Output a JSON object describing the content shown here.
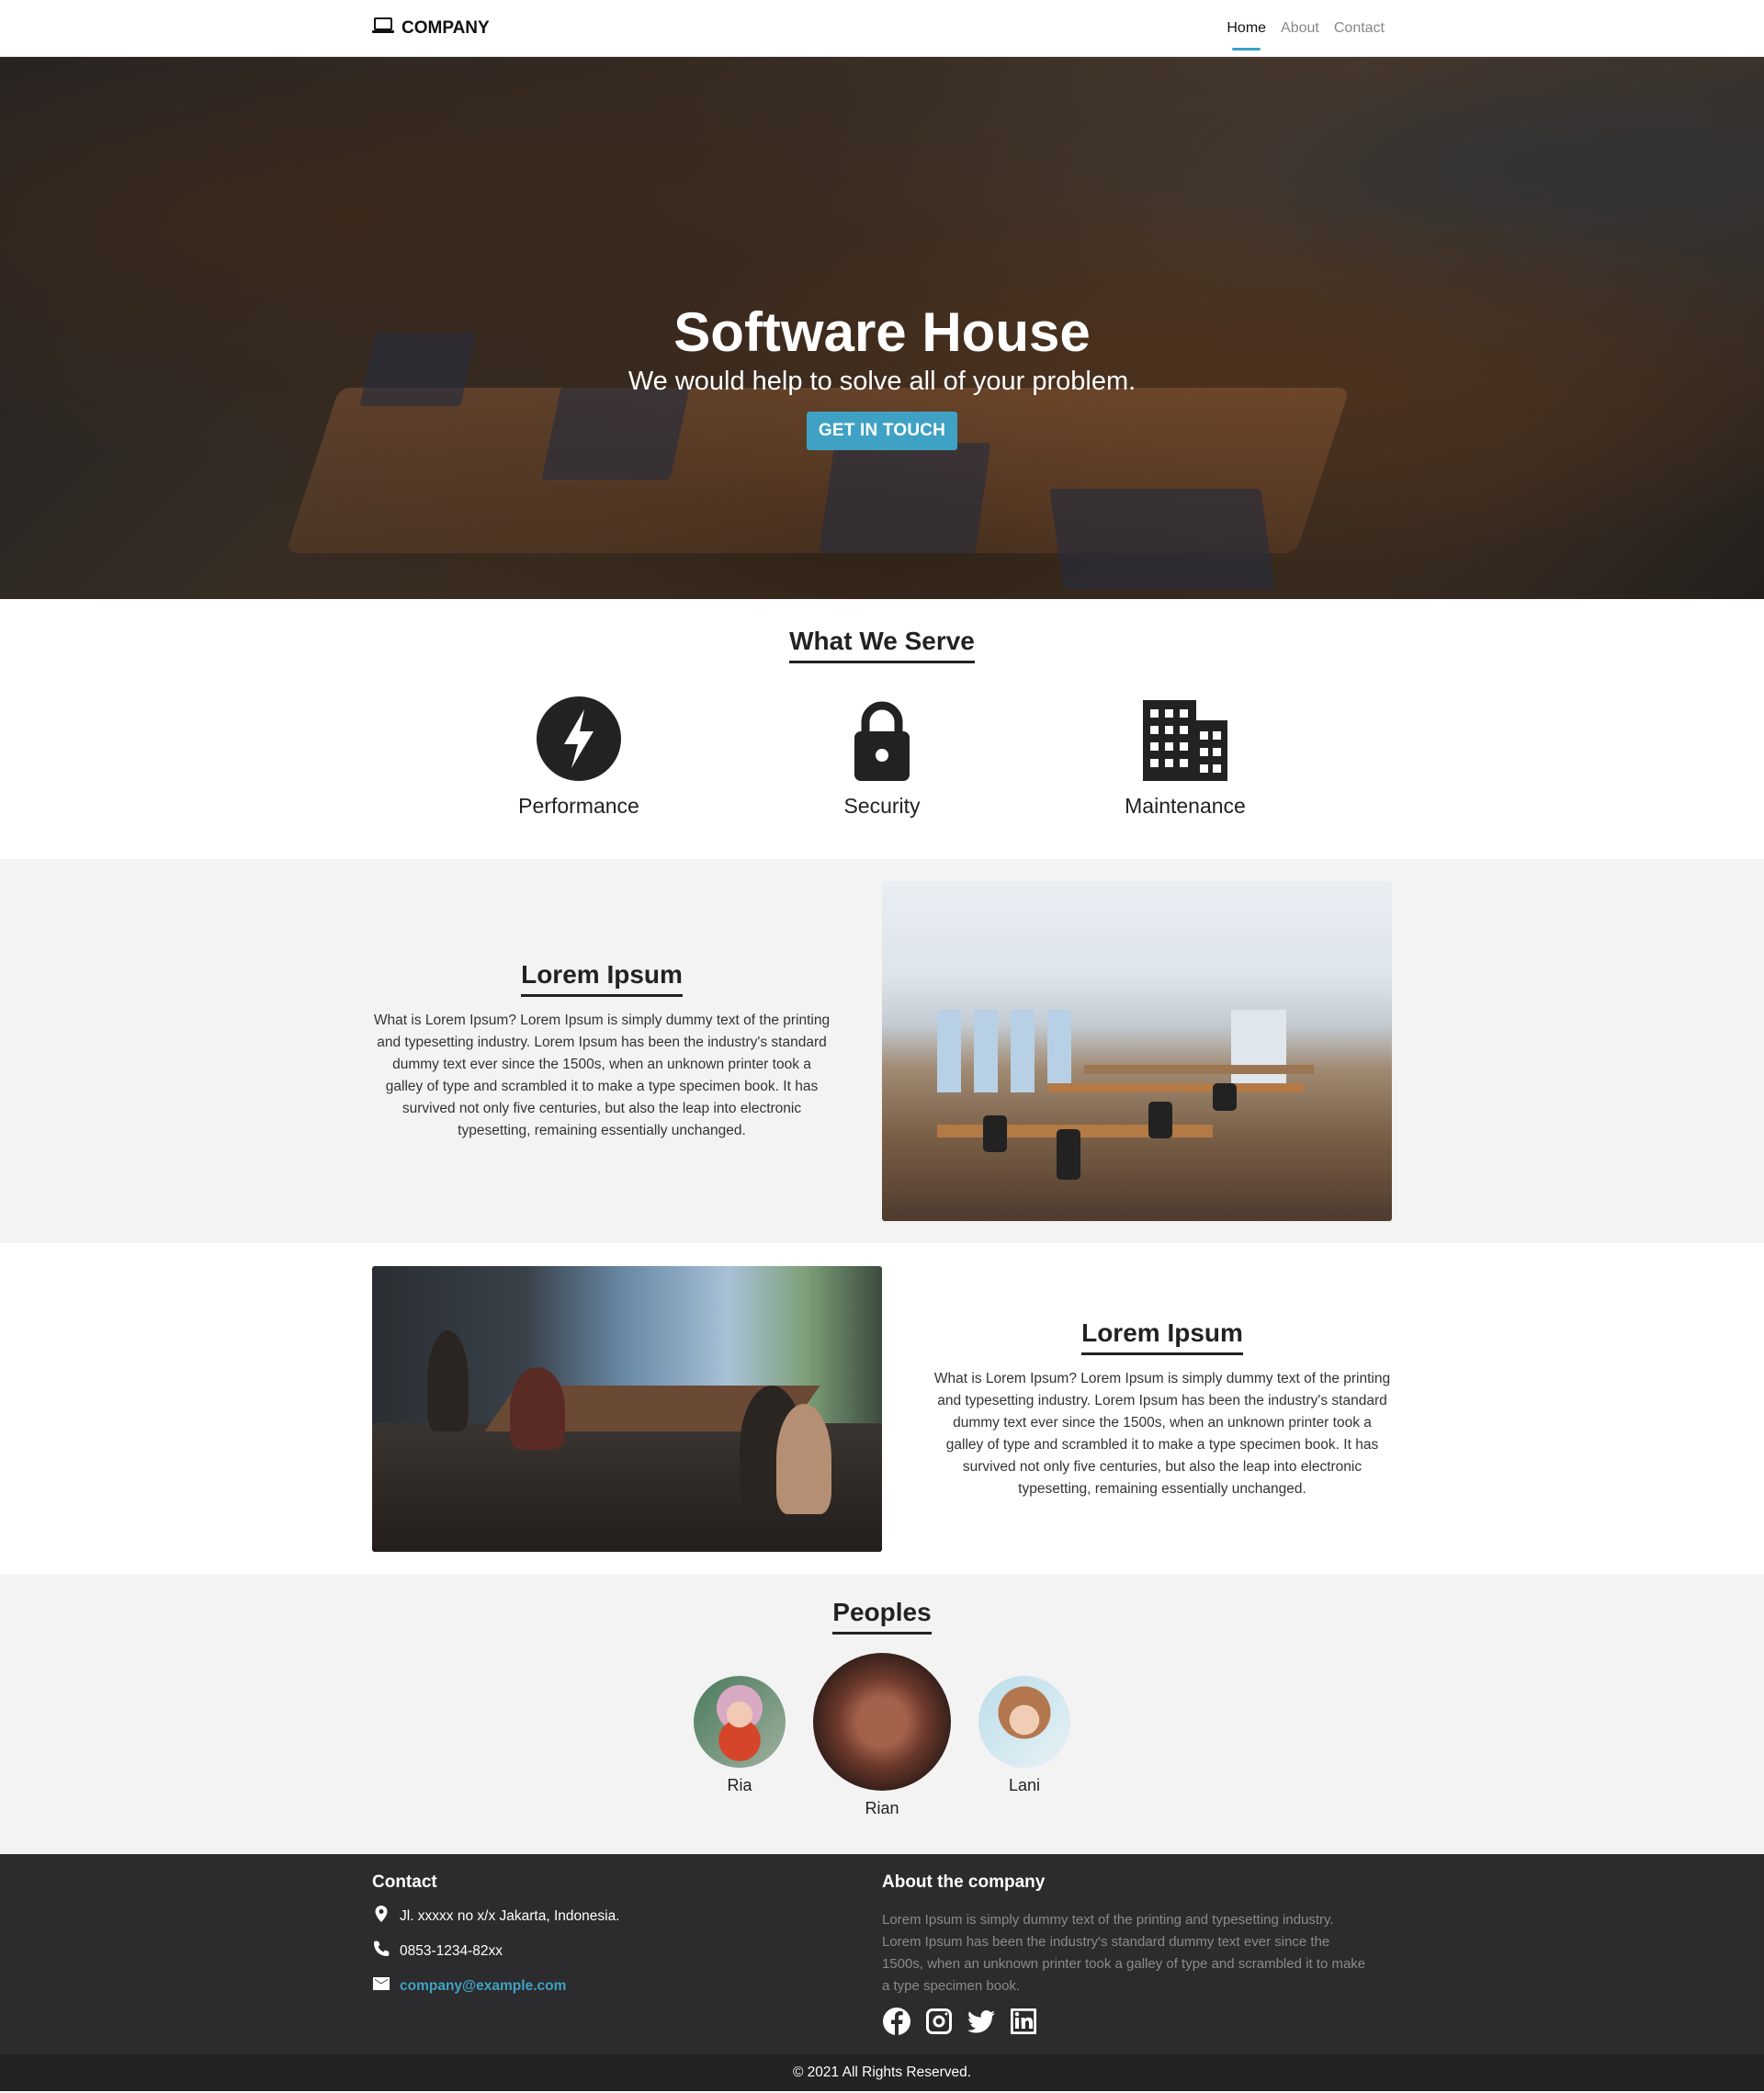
{
  "navbar": {
    "brand": "COMPANY",
    "links": [
      {
        "label": "Home",
        "active": true
      },
      {
        "label": "About",
        "active": false
      },
      {
        "label": "Contact",
        "active": false
      }
    ],
    "active_color": "#3aa2c4"
  },
  "hero": {
    "title": "Software House",
    "subtitle": "We would help to solve all of your problem.",
    "cta_label": "GET IN TOUCH",
    "cta_color": "#3fa2c4"
  },
  "serve": {
    "title": "What We Serve",
    "items": [
      {
        "icon": "bolt-icon",
        "label": "Performance"
      },
      {
        "icon": "lock-icon",
        "label": "Security"
      },
      {
        "icon": "building-icon",
        "label": "Maintenance"
      }
    ]
  },
  "features": [
    {
      "title": "Lorem Ipsum",
      "text": "What is Lorem Ipsum? Lorem Ipsum is simply dummy text of the printing and typesetting industry. Lorem Ipsum has been the industry's standard dummy text ever since the 1500s, when an unknown printer took a galley of type and scrambled it to make a type specimen book. It has survived not only five centuries, but also the leap into electronic typesetting, remaining essentially unchanged."
    },
    {
      "title": "Lorem Ipsum",
      "text": "What is Lorem Ipsum? Lorem Ipsum is simply dummy text of the printing and typesetting industry. Lorem Ipsum has been the industry's standard dummy text ever since the 1500s, when an unknown printer took a galley of type and scrambled it to make a type specimen book. It has survived not only five centuries, but also the leap into electronic typesetting, remaining essentially unchanged."
    }
  ],
  "peoples": {
    "title": "Peoples",
    "members": [
      {
        "name": "Ria"
      },
      {
        "name": "Rian"
      },
      {
        "name": "Lani"
      }
    ]
  },
  "footer": {
    "contact_title": "Contact",
    "address": "Jl. xxxxx no x/x Jakarta, Indonesia.",
    "phone": "0853-1234-82xx",
    "email": "company@example.com",
    "about_title": "About the company",
    "about_text": "Lorem Ipsum is simply dummy text of the printing and typesetting industry. Lorem Ipsum has been the industry's standard dummy text ever since the 1500s, when an unknown printer took a galley of type and scrambled it to make a type specimen book.",
    "socials": [
      "facebook-icon",
      "instagram-icon",
      "twitter-icon",
      "linkedin-icon"
    ],
    "copyright": "© 2021 All Rights Reserved."
  }
}
